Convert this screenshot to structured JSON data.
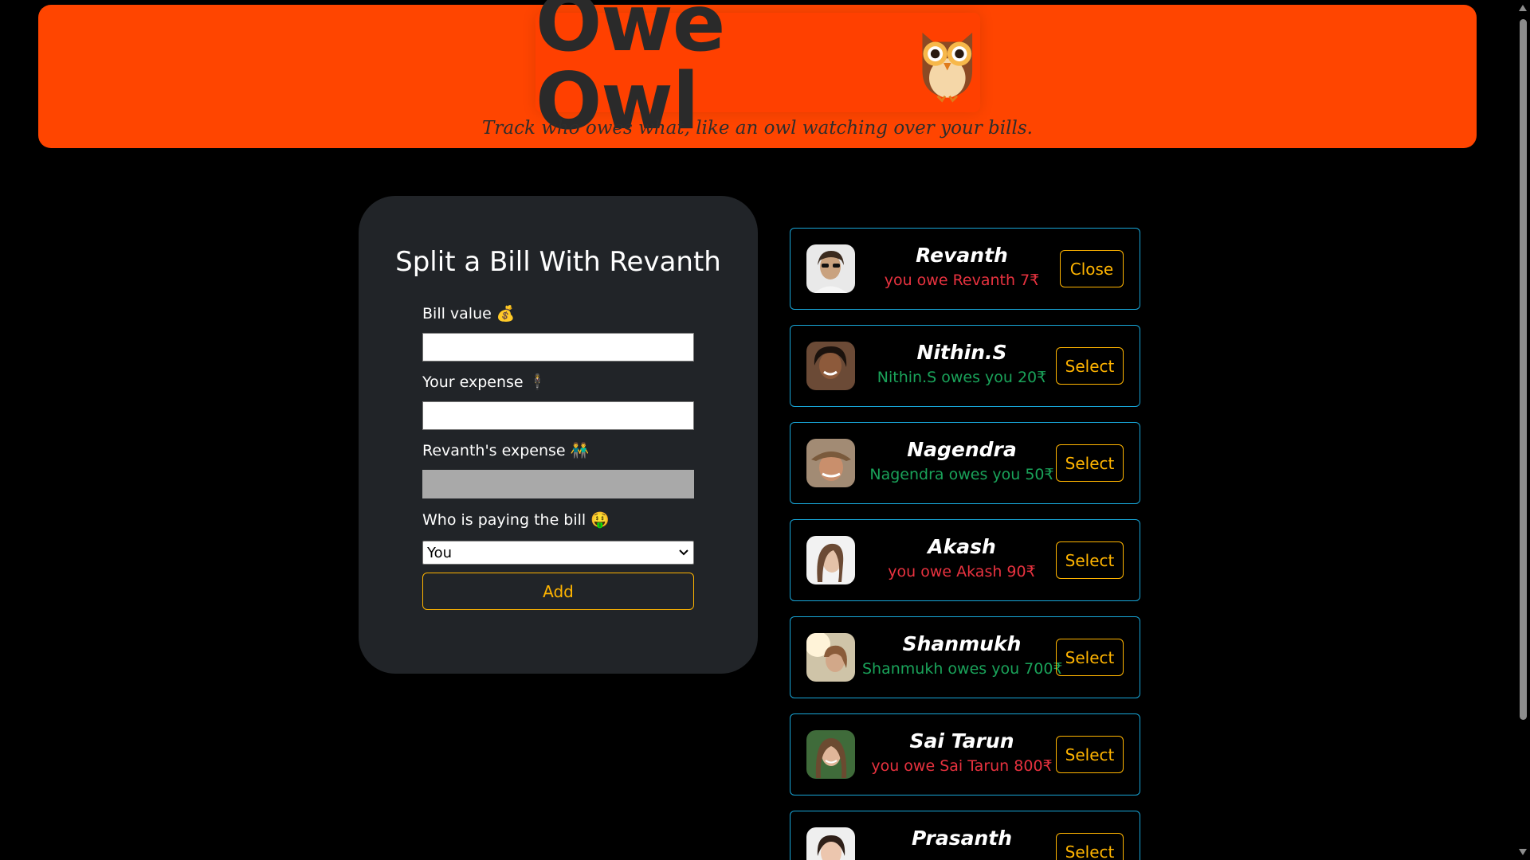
{
  "header": {
    "title": "Owe Owl",
    "subtitle": "Track who owes what, like an owl watching over your bills.",
    "logo_icon": "owl-icon"
  },
  "form": {
    "title": "Split a Bill With Revanth",
    "bill_value_label": "Bill value 💰",
    "your_expense_label": "Your expense 🕴",
    "friend_expense_label": "Revanth's expense 👬",
    "payer_label": "Who is paying the bill 🤑",
    "payer_selected": "You",
    "add_label": "Add"
  },
  "friends": [
    {
      "name": "Revanth",
      "status": "you owe Revanth 7₹",
      "balance": -7,
      "button": "Close",
      "selected": true
    },
    {
      "name": "Nithin.S",
      "status": "Nithin.S owes you 20₹",
      "balance": 20,
      "button": "Select",
      "selected": false
    },
    {
      "name": "Nagendra",
      "status": "Nagendra owes you 50₹",
      "balance": 50,
      "button": "Select",
      "selected": false
    },
    {
      "name": "Akash",
      "status": "you owe Akash 90₹",
      "balance": -90,
      "button": "Select",
      "selected": false
    },
    {
      "name": "Shanmukh",
      "status": "Shanmukh owes you 700₹",
      "balance": 700,
      "button": "Select",
      "selected": false
    },
    {
      "name": "Sai Tarun",
      "status": "you owe Sai Tarun 800₹",
      "balance": -800,
      "button": "Select",
      "selected": false
    },
    {
      "name": "Prasanth",
      "status": "",
      "balance": null,
      "button": "Select",
      "selected": false
    }
  ],
  "colors": {
    "header_bg": "#ff4500",
    "accent": "#ffb400",
    "card_border": "#18a6d8",
    "owe_red": "#e8323f",
    "owe_green": "#1aa35a"
  }
}
